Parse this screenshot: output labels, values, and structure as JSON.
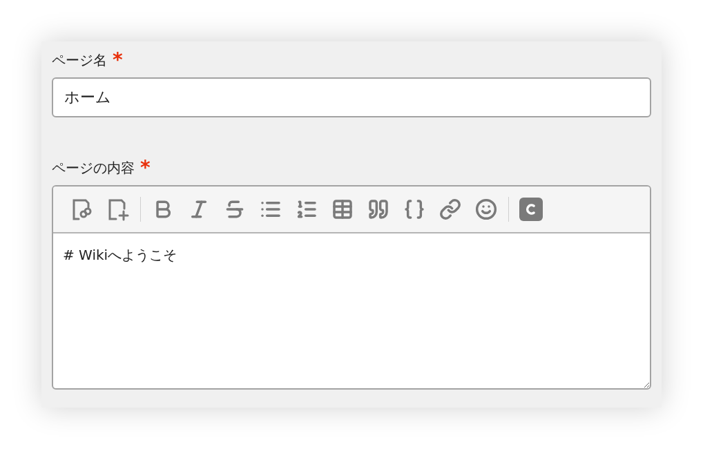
{
  "fields": [
    {
      "kind": "text",
      "label": "ページ名",
      "required_mark": "*",
      "value": "ホーム"
    },
    {
      "kind": "editor",
      "label": "ページの内容",
      "required_mark": "*",
      "value": "# Wikiへようこそ"
    }
  ]
}
